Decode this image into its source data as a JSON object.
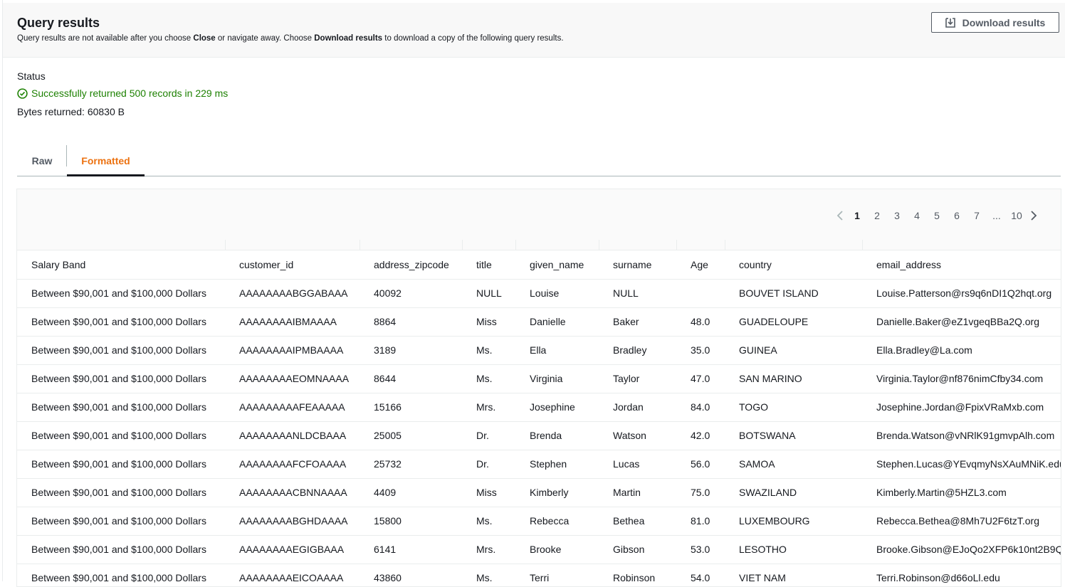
{
  "header": {
    "title": "Query results",
    "desc_1": "Query results are not available after you choose ",
    "desc_b1": "Close",
    "desc_2": " or navigate away. Choose ",
    "desc_b2": "Download results",
    "desc_3": " to download a copy of the following query results.",
    "download_label": "Download results"
  },
  "status": {
    "label": "Status",
    "message": "Successfully returned 500 records in 229 ms",
    "bytes": "Bytes returned: 60830 B"
  },
  "tabs": [
    {
      "label": "Raw",
      "active": false
    },
    {
      "label": "Formatted",
      "active": true
    }
  ],
  "pagination": {
    "pages": [
      "1",
      "2",
      "3",
      "4",
      "5",
      "6",
      "7",
      "...",
      "10"
    ],
    "current": "1"
  },
  "table": {
    "columns": [
      "Salary Band",
      "customer_id",
      "address_zipcode",
      "title",
      "given_name",
      "surname",
      "Age",
      "country",
      "email_address"
    ],
    "rows": [
      [
        "Between $90,001 and $100,000 Dollars",
        "AAAAAAAABGGABAAA",
        "40092",
        "NULL",
        "Louise",
        "NULL",
        "",
        "BOUVET ISLAND",
        "Louise.Patterson@rs9q6nDI1Q2hqt.org"
      ],
      [
        "Between $90,001 and $100,000 Dollars",
        "AAAAAAAAIBMAAAA",
        "8864",
        "Miss",
        "Danielle",
        "Baker",
        "48.0",
        "GUADELOUPE",
        "Danielle.Baker@eZ1vgeqBBa2Q.org"
      ],
      [
        "Between $90,001 and $100,000 Dollars",
        "AAAAAAAAIPMBAAAA",
        "3189",
        "Ms.",
        "Ella",
        "Bradley",
        "35.0",
        "GUINEA",
        "Ella.Bradley@La.com"
      ],
      [
        "Between $90,001 and $100,000 Dollars",
        "AAAAAAAAEOMNAAAA",
        "8644",
        "Ms.",
        "Virginia",
        "Taylor",
        "47.0",
        "SAN MARINO",
        "Virginia.Taylor@nf876nimCfby34.com"
      ],
      [
        "Between $90,001 and $100,000 Dollars",
        "AAAAAAAAAFEAAAAA",
        "15166",
        "Mrs.",
        "Josephine",
        "Jordan",
        "84.0",
        "TOGO",
        "Josephine.Jordan@FpixVRaMxb.com"
      ],
      [
        "Between $90,001 and $100,000 Dollars",
        "AAAAAAAANLDCBAAA",
        "25005",
        "Dr.",
        "Brenda",
        "Watson",
        "42.0",
        "BOTSWANA",
        "Brenda.Watson@vNRlK91gmvpAlh.com"
      ],
      [
        "Between $90,001 and $100,000 Dollars",
        "AAAAAAAAFCFOAAAA",
        "25732",
        "Dr.",
        "Stephen",
        "Lucas",
        "56.0",
        "SAMOA",
        "Stephen.Lucas@YEvqmyNsXAuMNiK.edu"
      ],
      [
        "Between $90,001 and $100,000 Dollars",
        "AAAAAAAACBNNAAAA",
        "4409",
        "Miss",
        "Kimberly",
        "Martin",
        "75.0",
        "SWAZILAND",
        "Kimberly.Martin@5HZL3.com"
      ],
      [
        "Between $90,001 and $100,000 Dollars",
        "AAAAAAAABGHDAAAA",
        "15800",
        "Ms.",
        "Rebecca",
        "Bethea",
        "81.0",
        "LUXEMBOURG",
        "Rebecca.Bethea@8Mh7U2F6tzT.org"
      ],
      [
        "Between $90,001 and $100,000 Dollars",
        "AAAAAAAAEGIGBAAA",
        "6141",
        "Mrs.",
        "Brooke",
        "Gibson",
        "53.0",
        "LESOTHO",
        "Brooke.Gibson@EJoQo2XFP6k10nt2B9Q"
      ],
      [
        "Between $90,001 and $100,000 Dollars",
        "AAAAAAAAEICOAAAA",
        "43860",
        "Ms.",
        "Terri",
        "Robinson",
        "54.0",
        "VIET NAM",
        "Terri.Robinson@d66oLl.edu"
      ]
    ]
  },
  "colors": {
    "success": "#1d8102",
    "active_tab": "#ec7211",
    "border": "#eaeded"
  }
}
